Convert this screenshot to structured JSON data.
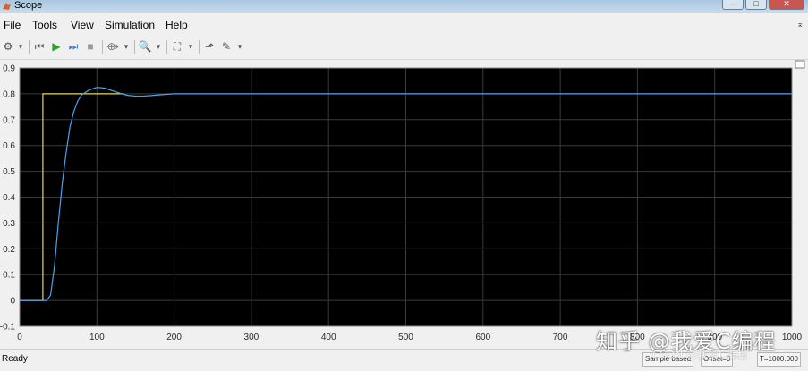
{
  "window": {
    "title": "Scope",
    "buttons": [
      "–",
      "□",
      "✕"
    ]
  },
  "menu": {
    "items": [
      "File",
      "Tools",
      "View",
      "Simulation",
      "Help"
    ]
  },
  "toolbar": {
    "buttons": [
      {
        "name": "settings-icon",
        "glyph": "⚙",
        "color": "#555555"
      },
      {
        "name": "dropdown-arrow-icon",
        "glyph": "▾",
        "color": "#555555"
      },
      {
        "name": "step-back-icon",
        "glyph": "⏮",
        "color": "#6a6a6a"
      },
      {
        "name": "run-icon",
        "glyph": "▶",
        "color": "#2aa12a"
      },
      {
        "name": "step-forward-icon",
        "glyph": "⏭",
        "color": "#4a7fc7"
      },
      {
        "name": "stop-icon",
        "glyph": "■",
        "color": "#9a9a9a"
      },
      {
        "name": "highlight-icon",
        "glyph": "⟴",
        "color": "#777777"
      },
      {
        "name": "dropdown-arrow-icon",
        "glyph": "▾",
        "color": "#555555"
      },
      {
        "name": "zoom-icon",
        "glyph": "🔍",
        "color": "#555555"
      },
      {
        "name": "dropdown-arrow-icon",
        "glyph": "▾",
        "color": "#555555"
      },
      {
        "name": "fit-to-view-icon",
        "glyph": "⛶",
        "color": "#555555"
      },
      {
        "name": "dropdown-arrow-icon",
        "glyph": "▾",
        "color": "#555555"
      },
      {
        "name": "trigger-icon",
        "glyph": "⬏",
        "color": "#555555"
      },
      {
        "name": "edit-icon",
        "glyph": "✎",
        "color": "#555555"
      },
      {
        "name": "dropdown-arrow-icon",
        "glyph": "▾",
        "color": "#555555"
      }
    ]
  },
  "chart_data": {
    "type": "line",
    "xlim": [
      0,
      1000
    ],
    "ylim": [
      -0.1,
      0.9
    ],
    "xticks": [
      0,
      100,
      200,
      300,
      400,
      500,
      600,
      700,
      800,
      900,
      1000
    ],
    "xtick_labels": [
      "0",
      "100",
      "200",
      "300",
      "400",
      "500",
      "600",
      "700",
      "800",
      "900",
      "1000"
    ],
    "yticks": [
      -0.1,
      0,
      0.1,
      0.2,
      0.3,
      0.4,
      0.5,
      0.6,
      0.7,
      0.8,
      0.9
    ],
    "ytick_labels": [
      "-0.1",
      "0",
      "0.1",
      "0.2",
      "0.3",
      "0.4",
      "0.5",
      "0.6",
      "0.7",
      "0.8",
      "0.9"
    ],
    "grid": true,
    "background": "#000000",
    "series": [
      {
        "color": "#e6d94a",
        "x": [
          0,
          30,
          30,
          135
        ],
        "y": [
          0,
          0,
          0.8,
          0.8
        ]
      },
      {
        "color": "#4aa3f0",
        "x": [
          0,
          35,
          40,
          45,
          50,
          55,
          60,
          65,
          70,
          75,
          80,
          90,
          100,
          110,
          120,
          130,
          140,
          150,
          160,
          170,
          180,
          190,
          200,
          220,
          250,
          1000
        ],
        "y": [
          0,
          0,
          0.02,
          0.13,
          0.3,
          0.45,
          0.57,
          0.67,
          0.73,
          0.77,
          0.795,
          0.815,
          0.825,
          0.822,
          0.812,
          0.802,
          0.794,
          0.791,
          0.791,
          0.793,
          0.796,
          0.798,
          0.8,
          0.8,
          0.8,
          0.8
        ]
      }
    ]
  },
  "status": {
    "left": "Ready",
    "cells": [
      "Sample based",
      "Offset=0",
      "T=1000.000"
    ]
  },
  "watermark": {
    "main": "知乎 @我爱C编程",
    "sub": "CSDN @我爱C编程"
  }
}
